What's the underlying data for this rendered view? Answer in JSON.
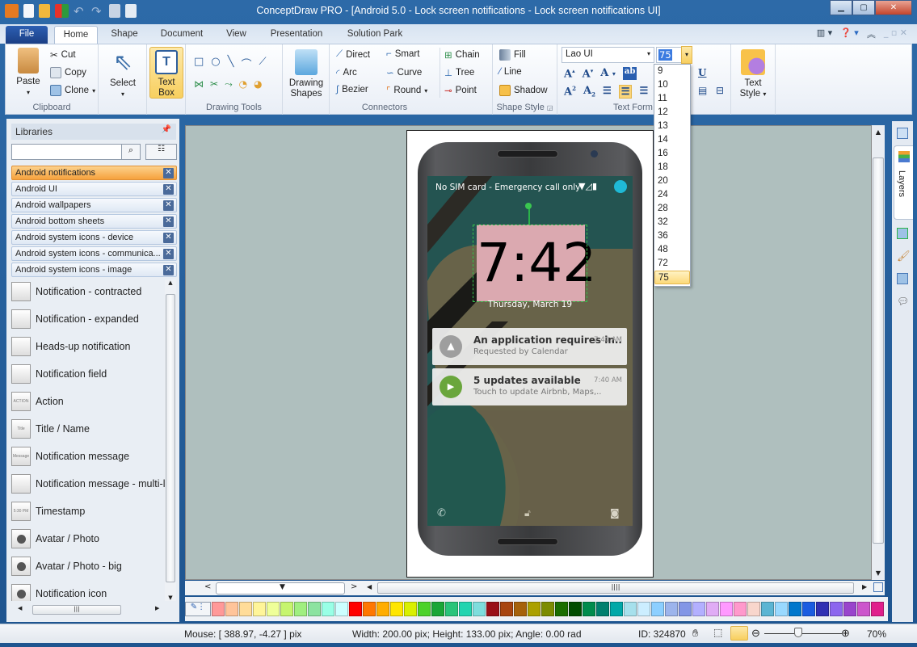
{
  "window": {
    "title": "ConceptDraw PRO - [Android 5.0 - Lock screen notifications - Lock screen notifications UI]",
    "controls": [
      "minimize",
      "maximize",
      "close"
    ]
  },
  "quick_access": [
    "app-icon",
    "new-icon",
    "open-icon",
    "colors-icon",
    "undo-icon",
    "redo-icon",
    "save-icon",
    "preview-icon"
  ],
  "tabs": [
    {
      "label": "File",
      "active": false
    },
    {
      "label": "Home",
      "active": true
    },
    {
      "label": "Shape",
      "active": false
    },
    {
      "label": "Document",
      "active": false
    },
    {
      "label": "View",
      "active": false
    },
    {
      "label": "Presentation",
      "active": false
    },
    {
      "label": "Solution Park",
      "active": false
    }
  ],
  "ribbon": {
    "clipboard": {
      "label": "Clipboard",
      "paste": "Paste",
      "cut": "Cut",
      "copy": "Copy",
      "clone": "Clone"
    },
    "select": {
      "label": "Select"
    },
    "textbox": {
      "label_line1": "Text",
      "label_line2": "Box"
    },
    "drawing_tools": {
      "label": "Drawing Tools"
    },
    "drawing_shapes": {
      "label_line1": "Drawing",
      "label_line2": "Shapes"
    },
    "connectors": {
      "label": "Connectors",
      "direct": "Direct",
      "smart": "Smart",
      "arc": "Arc",
      "curve": "Curve",
      "bezier": "Bezier",
      "round": "Round",
      "chain": "Chain",
      "tree": "Tree",
      "point": "Point"
    },
    "shape_style": {
      "label": "Shape Style",
      "fill": "Fill",
      "line": "Line",
      "shadow": "Shadow"
    },
    "text_format": {
      "label": "Text Form",
      "font": "Lao UI",
      "size": "75",
      "size_options": [
        "9",
        "10",
        "11",
        "12",
        "13",
        "14",
        "16",
        "18",
        "20",
        "24",
        "28",
        "32",
        "36",
        "48",
        "72",
        "75"
      ],
      "size_selected": "75"
    },
    "text_style": {
      "label_line1": "Text",
      "label_line2": "Style"
    }
  },
  "libraries": {
    "title": "Libraries",
    "search_value": "",
    "list": [
      {
        "name": "Android notifications",
        "active": true
      },
      {
        "name": "Android UI",
        "active": false
      },
      {
        "name": "Android wallpapers",
        "active": false
      },
      {
        "name": "Android bottom sheets",
        "active": false
      },
      {
        "name": "Android system icons - device",
        "active": false
      },
      {
        "name": "Android system icons - communica...",
        "active": false
      },
      {
        "name": "Android system icons - image",
        "active": false
      }
    ],
    "shapes": [
      {
        "name": "Notification - contracted",
        "thumb": ""
      },
      {
        "name": "Notification - expanded",
        "thumb": ""
      },
      {
        "name": "Heads-up notification",
        "thumb": ""
      },
      {
        "name": "Notification field",
        "thumb": ""
      },
      {
        "name": "Action",
        "thumb": "ACTION"
      },
      {
        "name": "Title / Name",
        "thumb": "Title"
      },
      {
        "name": "Notification message",
        "thumb": "Message"
      },
      {
        "name": "Notification message - multi-l",
        "thumb": ""
      },
      {
        "name": "Timestamp",
        "thumb": "5:30 PM"
      },
      {
        "name": "Avatar / Photo",
        "thumb": ""
      },
      {
        "name": "Avatar / Photo - big",
        "thumb": ""
      },
      {
        "name": "Notification icon",
        "thumb": ""
      }
    ]
  },
  "phone": {
    "status_text": "No SIM card - Emergency call only",
    "clock": "7:42",
    "date": "Thursday, March 19",
    "notifications": [
      {
        "title": "An application requires in..",
        "subtitle": "Requested by Calendar",
        "time": "7:40 AM",
        "icon_color": "#9e9e9e",
        "icon": "warning-icon"
      },
      {
        "title": "5 updates available",
        "subtitle": "Touch to update Airbnb, Maps,..",
        "time": "7:40 AM",
        "icon_color": "#6aa63c",
        "icon": "store-icon"
      }
    ]
  },
  "side_panel": {
    "layers_tab": "Layers"
  },
  "palette": [
    "#ff9999",
    "#ffc49a",
    "#ffdc99",
    "#fff599",
    "#efff99",
    "#c6f56e",
    "#a0ef80",
    "#8ce3a0",
    "#99ffe6",
    "#ccffff",
    "#ff0000",
    "#ff7700",
    "#ffad00",
    "#ffe600",
    "#d9f000",
    "#4cd22a",
    "#1aa637",
    "#29c47a",
    "#22d4b0",
    "#7edddd",
    "#990f17",
    "#a8450f",
    "#a6620b",
    "#aba000",
    "#7c8c00",
    "#1a6e00",
    "#004c00",
    "#008c4d",
    "#00806e",
    "#00a8a8",
    "#a6e0ec",
    "#cceeff",
    "#8ccfff",
    "#9cb4ec",
    "#8396e6",
    "#b3b0ff",
    "#e0acf5",
    "#ff99ff",
    "#ff99cc",
    "#f8d6cc",
    "#5bb5d3",
    "#99d9ff",
    "#0077cc",
    "#1a5ce0",
    "#3030b3",
    "#8c66ee",
    "#9944cc",
    "#cc55cc",
    "#e0208c"
  ],
  "status": {
    "mouse": "Mouse: [ 388.97, -4.27 ] pix",
    "dims": "Width: 200.00 pix;  Height: 133.00 pix;  Angle: 0.00 rad",
    "id": "ID: 324870",
    "zoom": "70%",
    "zoom_fraction": 0.44
  }
}
